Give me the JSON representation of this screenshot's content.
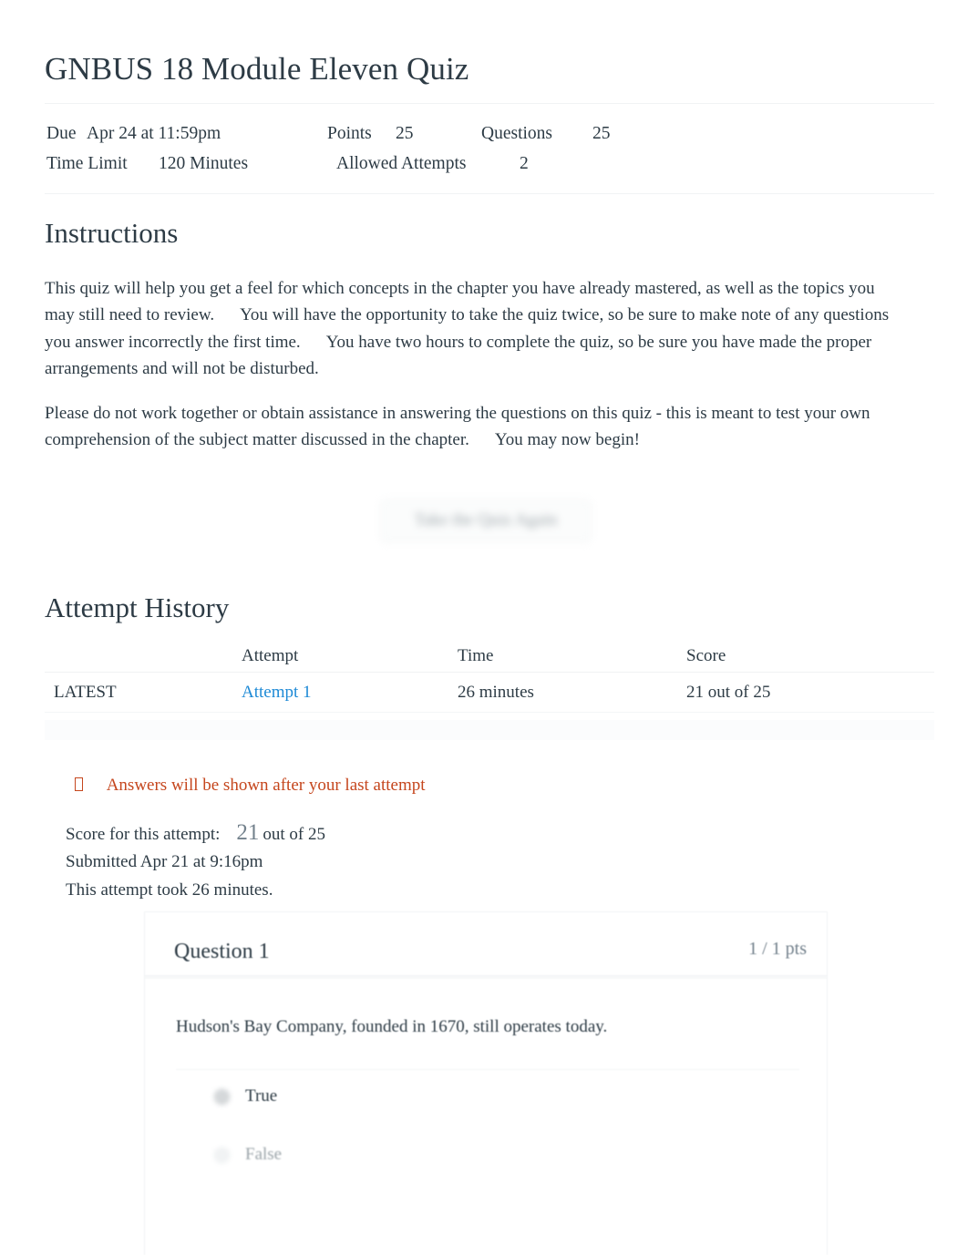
{
  "quiz": {
    "title": "GNBUS 18 Module Eleven Quiz",
    "meta": {
      "due_label": "Due",
      "due_value": "Apr 24 at 11:59pm",
      "points_label": "Points",
      "points_value": "25",
      "questions_label": "Questions",
      "questions_value": "25",
      "time_limit_label": "Time Limit",
      "time_limit_value": "120 Minutes",
      "allowed_attempts_label": "Allowed Attempts",
      "allowed_attempts_value": "2"
    }
  },
  "instructions": {
    "heading": "Instructions",
    "paragraph_1_a": "This quiz will help you get a feel for which concepts in the chapter you have already mastered, as well as the topics you may still need to review.",
    "paragraph_1_b": "You will have the opportunity to take the quiz twice, so be sure to make note of any questions you answer incorrectly the first time.",
    "paragraph_1_c": "You have two hours to complete the quiz, so be sure you have made the proper arrangements and will not be disturbed.",
    "paragraph_2_a": "Please do not work together or obtain assistance in answering the questions on this quiz - this is meant to test your own comprehension of the subject matter discussed in the chapter.",
    "paragraph_2_b": "You may now begin!"
  },
  "retake_button": {
    "label": "Take the Quiz Again"
  },
  "attempt_history": {
    "heading": "Attempt History",
    "columns": [
      "",
      "Attempt",
      "Time",
      "Score"
    ],
    "rows": [
      {
        "kept": "LATEST",
        "attempt": "Attempt 1",
        "time": "26 minutes",
        "score": "21 out of 25"
      }
    ]
  },
  "answers_notice": {
    "icon": "info-circle-icon",
    "text": "Answers will be shown after your last attempt",
    "color": "#c5461d"
  },
  "score_summary": {
    "score_label": "Score for this attempt:",
    "score_value": "21",
    "score_out_of": "out of 25",
    "submitted": "Submitted Apr 21 at 9:16pm",
    "duration": "This attempt took 26 minutes."
  },
  "question": {
    "title": "Question 1",
    "points": "1 / 1 pts",
    "text": "Hudson's Bay Company, founded in 1670, still operates today.",
    "answers": [
      {
        "label": "True",
        "selected": true
      },
      {
        "label": "False",
        "selected": false
      }
    ]
  },
  "colors": {
    "link": "#1e8ad6",
    "text": "#2d3b45",
    "muted": "#73818c",
    "notice": "#c5461d"
  }
}
